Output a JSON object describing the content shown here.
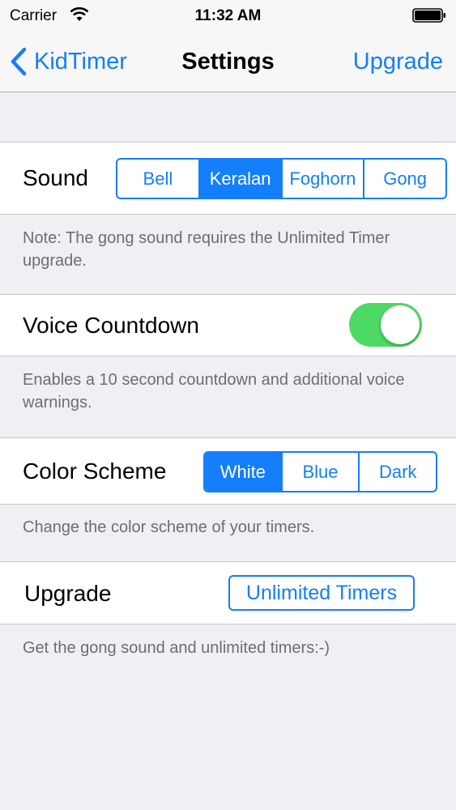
{
  "status_bar": {
    "carrier": "Carrier",
    "time": "11:32 AM"
  },
  "nav": {
    "back_label": "KidTimer",
    "title": "Settings",
    "upgrade_label": "Upgrade"
  },
  "sound": {
    "label": "Sound",
    "options": [
      "Bell",
      "Keralan",
      "Foghorn",
      "Gong"
    ],
    "selected": "Keralan",
    "note": "Note: The gong sound requires the Unlimited Timer upgrade."
  },
  "voice_countdown": {
    "label": "Voice Countdown",
    "enabled": true,
    "note": "Enables a 10 second countdown and additional voice warnings."
  },
  "color_scheme": {
    "label": "Color Scheme",
    "options": [
      "White",
      "Blue",
      "Dark"
    ],
    "selected": "White",
    "note": "Change the color scheme of your timers."
  },
  "upgrade": {
    "label": "Upgrade",
    "button_label": "Unlimited Timers",
    "note": "Get the gong sound and unlimited timers:-)"
  },
  "colors": {
    "accent": "#147efb",
    "toggle_on": "#4cd964",
    "background": "#efeff4"
  },
  "icons": {
    "back": "chevron-left-icon",
    "wifi": "wifi-icon",
    "battery": "battery-icon"
  }
}
